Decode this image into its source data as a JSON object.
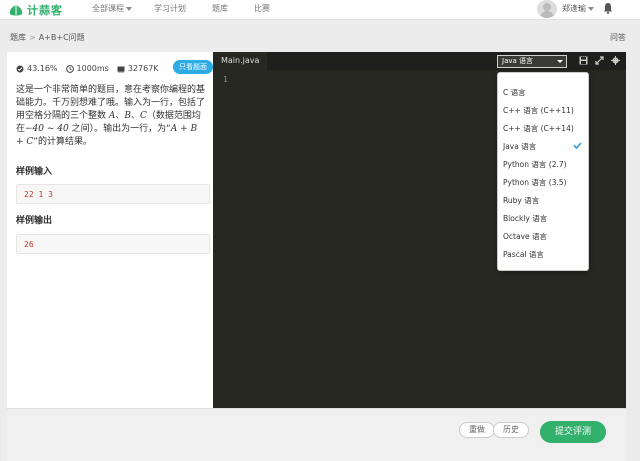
{
  "nav": {
    "logo_text": "计蒜客",
    "items": [
      "全部课程",
      "学习计划",
      "题库",
      "比赛"
    ],
    "username": "郑逢瑜"
  },
  "breadcrumb": {
    "root": "题库",
    "current": "A+B+C问题",
    "right_link": "问答"
  },
  "problem": {
    "stats": {
      "pass_rate": "43.16%",
      "time_limit": "1000ms",
      "memory_limit": "32767K"
    },
    "only_button": "只看题面",
    "description": {
      "part1": "这是一个非常简单的题目，意在考察你编程的基础能力。千万别想难了哦。输入为一行，包括了用空格分隔的三个整数 ",
      "var_a": "A",
      "sep1": "、",
      "var_b": "B",
      "sep2": "、",
      "var_c": "C",
      "part2": "（数据范围均在",
      "range": "−40 ~ 40",
      "part3": " 之间）。输出为一行，为“",
      "expr": "A + B + C",
      "part4": "”的计算结果。"
    },
    "sample_input_title": "样例输入",
    "sample_input": "22 1 3",
    "sample_output_title": "样例输出",
    "sample_output": "26"
  },
  "editor": {
    "tab": "Main.java",
    "selected_language": "Java 语言",
    "line_numbers": [
      "1"
    ]
  },
  "language_menu": {
    "items": [
      "C 语言",
      "C++ 语言 (C++11)",
      "C++ 语言 (C++14)",
      "Java 语言",
      "Python 语言 (2.7)",
      "Python 语言 (3.5)",
      "Ruby 语言",
      "Blockly 语言",
      "Octave 语言",
      "Pascal 语言"
    ],
    "checked_index": 3
  },
  "actions": {
    "reset": "重做",
    "history": "历史",
    "submit": "提交评测"
  },
  "colors": {
    "brand_green": "#32b16c",
    "button_blue": "#2dabe3",
    "editor_bg": "#272822",
    "check_blue": "#2d9cdb"
  }
}
